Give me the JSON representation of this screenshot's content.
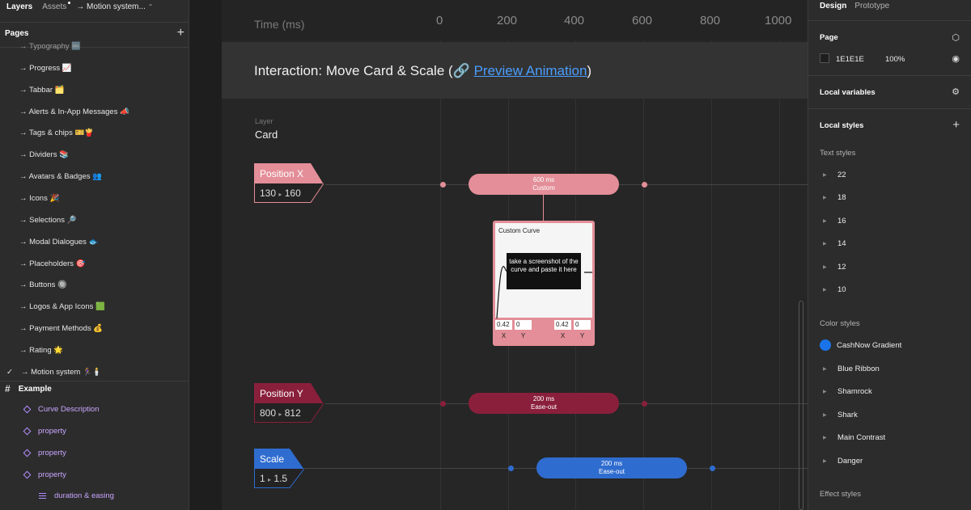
{
  "left_panel": {
    "tabs": [
      {
        "label": "Layers"
      },
      {
        "label": "Assets"
      }
    ],
    "file_name": "→ Motion system...",
    "pages_title": "Pages",
    "pages": [
      {
        "label": "→ Typography 🔤"
      },
      {
        "label": "→ Progress 📈"
      },
      {
        "label": "→ Tabbar 🗂️"
      },
      {
        "label": "→ Alerts & In-App Messages 📣"
      },
      {
        "label": "→ Tags & chips 🎫🍟"
      },
      {
        "label": "→ Dividers 📚"
      },
      {
        "label": "→ Avatars & Badges 👥"
      },
      {
        "label": "→ Icons 🎉"
      },
      {
        "label": "→ Selections 🔎"
      },
      {
        "label": "→ Modal Dialogues 🐟"
      },
      {
        "label": "→ Placeholders 🎯"
      },
      {
        "label": "→ Buttons 🔘"
      },
      {
        "label": "→ Logos & App Icons 🟩"
      },
      {
        "label": "→ Payment Methods 💰"
      },
      {
        "label": "→ Rating 🌟"
      }
    ],
    "current_page": "→ Motion system 🏃‍♀️🕯️",
    "frame_name": "Example",
    "layers": [
      {
        "label": "Curve Description"
      },
      {
        "label": "property"
      },
      {
        "label": "property"
      },
      {
        "label": "property"
      },
      {
        "label": "duration & easing"
      }
    ]
  },
  "canvas": {
    "time_label": "Time (ms)",
    "ticks": [
      "0",
      "200",
      "400",
      "600",
      "800",
      "1000"
    ],
    "title_prefix": "Interaction: Move Card & Scale  (🔗 ",
    "title_link": "Preview  Animation",
    "title_suffix": ")",
    "layer_caption": "Layer",
    "layer_name": "Card",
    "properties": [
      {
        "name": "Position X",
        "from": "130",
        "arrow": "▸",
        "to": "160",
        "pill_duration": "600 ms",
        "pill_easing": "Custom",
        "color": "#e38e98"
      },
      {
        "name": "Position Y",
        "from": "800",
        "arrow": "▸",
        "to": "812",
        "pill_duration": "200 ms",
        "pill_easing": "Ease-out",
        "color": "#8a1f3c"
      },
      {
        "name": "Scale",
        "from": "1",
        "arrow": "▸",
        "to": "1.5",
        "pill_duration": "200 ms",
        "pill_easing": "Ease-out",
        "color": "#2f6ccf"
      }
    ],
    "curve_card": {
      "title": "Custom Curve",
      "note": "take a screenshot of the curve and paste it here",
      "values": [
        "0.42",
        "0",
        "0.42",
        "0"
      ],
      "labels": [
        "X",
        "Y",
        "X",
        "Y"
      ]
    }
  },
  "right_panel": {
    "tabs": [
      {
        "label": "Design"
      },
      {
        "label": "Prototype"
      }
    ],
    "page_title": "Page",
    "page_color": "1E1E1E",
    "page_opacity": "100%",
    "local_variables": "Local variables",
    "local_styles": "Local styles",
    "text_styles_title": "Text styles",
    "text_styles": [
      "22",
      "18",
      "16",
      "14",
      "12",
      "10"
    ],
    "color_styles_title": "Color styles",
    "color_styles": [
      "CashNow Gradient",
      "Blue Ribbon",
      "Shamrock",
      "Shark",
      "Main Contrast",
      "Danger"
    ],
    "effect_styles_title": "Effect styles"
  }
}
